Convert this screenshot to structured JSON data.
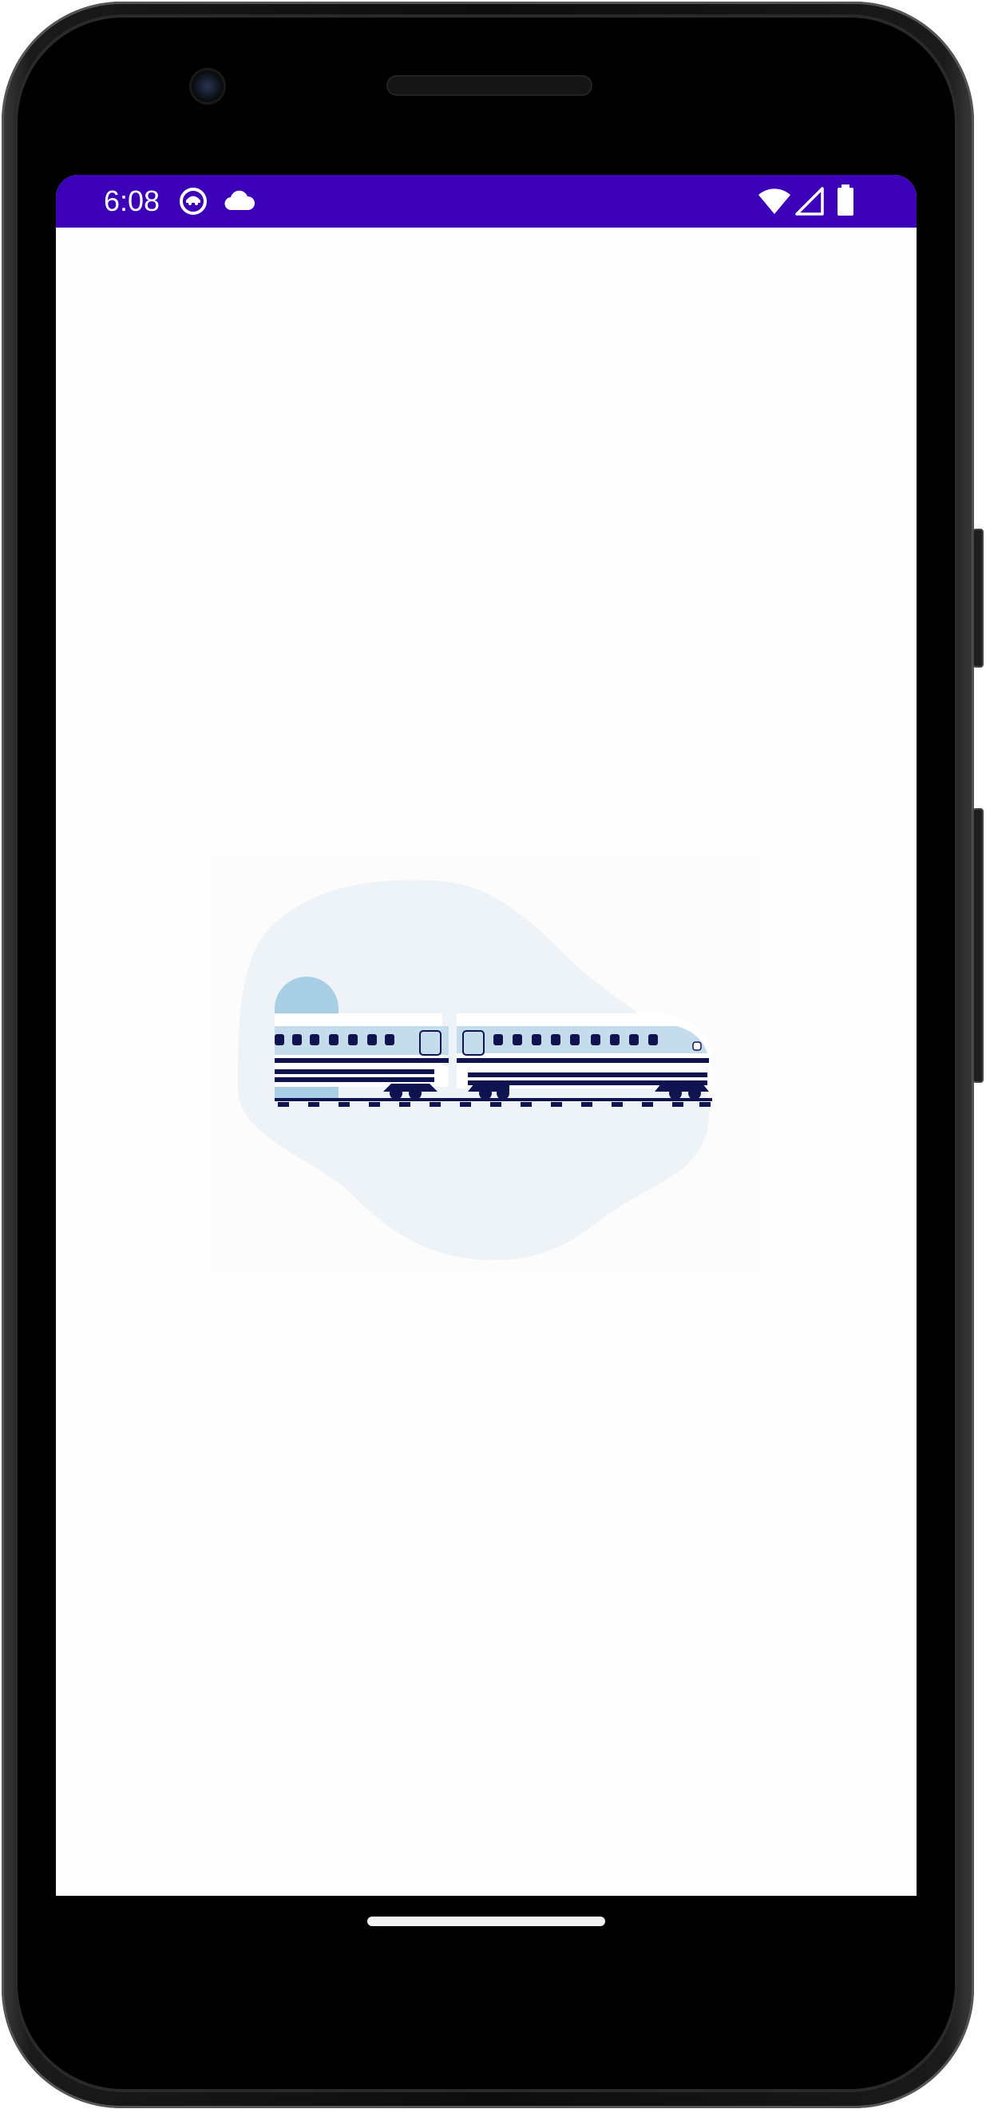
{
  "status_bar": {
    "time": "6:08",
    "background_color": "#3b00b8",
    "left_icons": [
      "face-notification-icon",
      "cloud-icon"
    ],
    "right_icons": [
      "wifi-icon",
      "cellular-signal-icon",
      "battery-icon"
    ]
  },
  "splash": {
    "illustration": "bullet-train-illustration",
    "colors": {
      "blob": "#eef3f8",
      "train_body": "#c5dcec",
      "train_dark": "#0f1450",
      "sun": "#a8cfe3"
    }
  },
  "navigation": {
    "home_indicator": "gesture-bar"
  }
}
